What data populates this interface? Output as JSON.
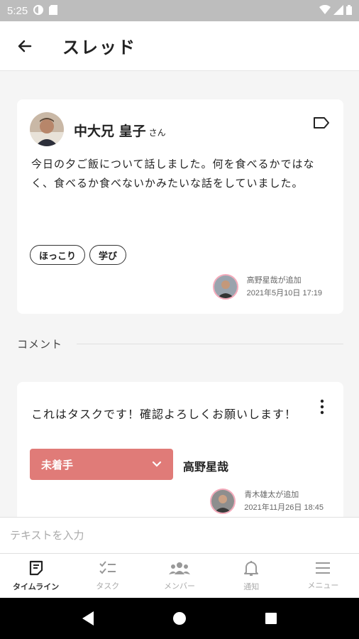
{
  "status_bar": {
    "time": "5:25"
  },
  "app_bar": {
    "title": "スレッド"
  },
  "post": {
    "author": "中大兄 皇子",
    "honorific": "さん",
    "body": "今日の夕ご飯について話しました。何を食べるかではなく、食べるか食べないかみたいな話をしていました。",
    "tags": [
      "ほっこり",
      "学び"
    ],
    "added_by": "高野星哉が追加",
    "added_at": "2021年5月10日 17:19"
  },
  "comments_section": {
    "label": "コメント"
  },
  "task": {
    "text": "これはタスクです！確認よろしくお願いします！",
    "status": "未着手",
    "assignee": "高野星哉",
    "added_by": "青木雄太が追加",
    "added_at": "2021年11月26日 18:45"
  },
  "input": {
    "placeholder": "テキストを入力"
  },
  "bottom_nav": {
    "items": [
      {
        "label": "タイムライン",
        "icon": "timeline-icon",
        "active": true
      },
      {
        "label": "タスク",
        "icon": "task-checklist-icon",
        "active": false
      },
      {
        "label": "メンバー",
        "icon": "members-icon",
        "active": false
      },
      {
        "label": "通知",
        "icon": "bell-icon",
        "active": false
      },
      {
        "label": "メニュー",
        "icon": "menu-icon",
        "active": false
      }
    ]
  },
  "colors": {
    "status_accent": "#e07b78",
    "avatar_ring": "#f4a9ba",
    "background": "#f5f5f5"
  }
}
